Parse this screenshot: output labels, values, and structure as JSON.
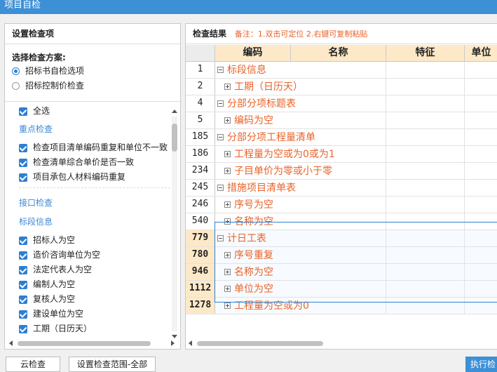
{
  "window": {
    "title": "项目自检"
  },
  "left": {
    "header": "设置检查项",
    "scheme_label": "选择检查方案:",
    "schemes": [
      {
        "label": "招标书自检选项",
        "selected": true
      },
      {
        "label": "招标控制价检查",
        "selected": false
      }
    ],
    "select_all": "全选",
    "groups": [
      {
        "title": "重点检查",
        "items": [
          "检查项目清单编码重复和单位不一致",
          "检查清单综合单价是否一致",
          "项目承包人材料编码重复"
        ]
      },
      {
        "title": "接口检查",
        "items": []
      },
      {
        "title": "标段信息",
        "items": [
          "招标人为空",
          "造价咨询单位为空",
          "法定代表人为空",
          "编制人为空",
          "复核人为空",
          "建设单位为空",
          "工期（日历天）"
        ]
      }
    ]
  },
  "right": {
    "header": "检查结果",
    "note": "备注：1.双击可定位 2.右键可复制粘贴",
    "columns": [
      "编码",
      "名称",
      "特征",
      "单位"
    ],
    "rows": [
      {
        "num": "1",
        "label": "标段信息",
        "level": 0,
        "icon": "minus"
      },
      {
        "num": "2",
        "label": "工期（日历天）",
        "level": 1,
        "icon": "plus"
      },
      {
        "num": "4",
        "label": "分部分项标题表",
        "level": 0,
        "icon": "minus"
      },
      {
        "num": "5",
        "label": "编码为空",
        "level": 1,
        "icon": "plus"
      },
      {
        "num": "185",
        "label": "分部分项工程量清单",
        "level": 0,
        "icon": "minus"
      },
      {
        "num": "186",
        "label": "工程量为空或为0或为1",
        "level": 1,
        "icon": "plus"
      },
      {
        "num": "234",
        "label": "子目单价为零或小于零",
        "level": 1,
        "icon": "plus"
      },
      {
        "num": "245",
        "label": "措施项目清单表",
        "level": 0,
        "icon": "minus"
      },
      {
        "num": "246",
        "label": "序号为空",
        "level": 1,
        "icon": "plus"
      },
      {
        "num": "540",
        "label": "名称为空",
        "level": 1,
        "icon": "plus"
      },
      {
        "num": "779",
        "label": "计日工表",
        "level": 0,
        "icon": "minus",
        "selected": true
      },
      {
        "num": "780",
        "label": "序号重复",
        "level": 1,
        "icon": "plus",
        "selected": true
      },
      {
        "num": "946",
        "label": "名称为空",
        "level": 1,
        "icon": "plus",
        "selected": true
      },
      {
        "num": "1112",
        "label": "单位为空",
        "level": 1,
        "icon": "plus",
        "selected": true
      },
      {
        "num": "1278",
        "label": "工程量为空或为0",
        "level": 1,
        "icon": "plus",
        "selected": true
      }
    ]
  },
  "footer": {
    "cloud_check": "云检查",
    "scope": "设置检查范围-全部",
    "execute": "执行检"
  }
}
